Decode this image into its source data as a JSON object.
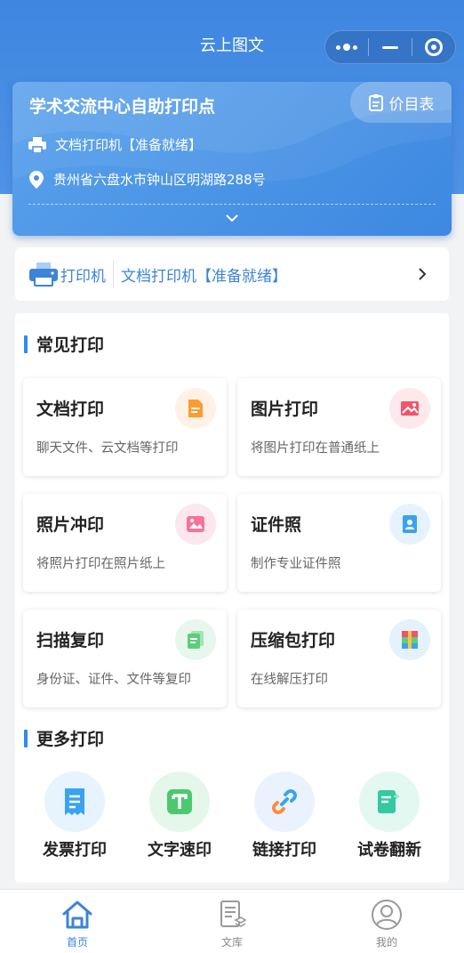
{
  "header": {
    "title": "云上图文"
  },
  "location_card": {
    "name": "学术交流中心自助打印点",
    "price_button": "价目表",
    "printer_line": "文档打印机【准备就绪】",
    "address": "贵州省六盘水市钟山区明湖路288号"
  },
  "printer_bar": {
    "label": "打印机",
    "status": "文档打印机【准备就绪】"
  },
  "common_print": {
    "title": "常见打印",
    "cards": [
      {
        "title": "文档打印",
        "desc": "聊天文件、云文档等打印",
        "icon": "document-icon",
        "color": "#ff9a2e"
      },
      {
        "title": "图片打印",
        "desc": "将图片打印在普通纸上",
        "icon": "image-icon",
        "color": "#f2546b"
      },
      {
        "title": "照片冲印",
        "desc": "将照片打印在照片纸上",
        "icon": "photo-icon",
        "color": "#f7739a"
      },
      {
        "title": "证件照",
        "desc": "制作专业证件照",
        "icon": "id-photo-icon",
        "color": "#3aa3f0"
      },
      {
        "title": "扫描复印",
        "desc": "身份证、证件、文件等复印",
        "icon": "scan-copy-icon",
        "color": "#5ccf7a"
      },
      {
        "title": "压缩包打印",
        "desc": "在线解压打印",
        "icon": "archive-icon",
        "color": "#3aa3f0"
      }
    ]
  },
  "more_print": {
    "title": "更多打印",
    "items": [
      {
        "label": "发票打印",
        "icon": "invoice-icon"
      },
      {
        "label": "文字速印",
        "icon": "text-print-icon"
      },
      {
        "label": "链接打印",
        "icon": "link-icon"
      },
      {
        "label": "试卷翻新",
        "icon": "exam-refresh-icon"
      }
    ]
  },
  "tabbar": {
    "tabs": [
      {
        "label": "首页",
        "icon": "home-icon"
      },
      {
        "label": "文库",
        "icon": "library-icon"
      },
      {
        "label": "我的",
        "icon": "profile-icon"
      }
    ]
  },
  "colors": {
    "primary": "#3c84d8",
    "header_blue": "#4a8fe4",
    "accent_bar": "#2d8cf0"
  }
}
